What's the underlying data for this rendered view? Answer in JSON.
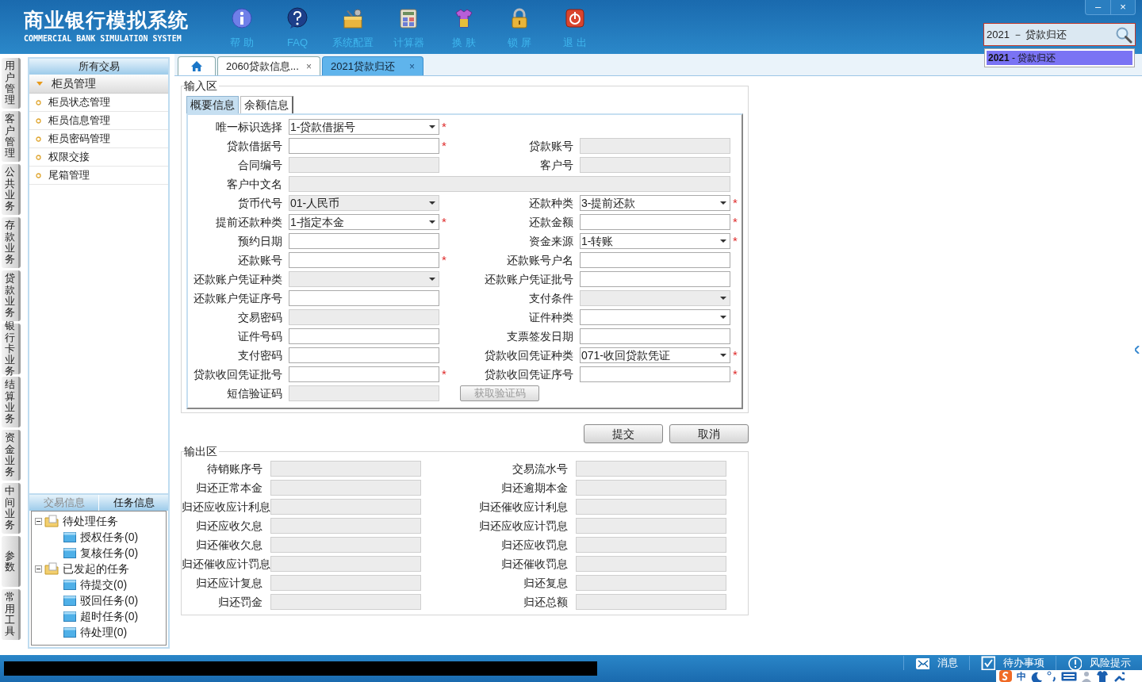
{
  "app": {
    "title": "商业银行模拟系统",
    "subtitle": "COMMERCIAL BANK SIMULATION SYSTEM"
  },
  "toolbar": [
    {
      "kind": "info",
      "label": "帮 助"
    },
    {
      "kind": "faq",
      "label": "FAQ"
    },
    {
      "kind": "config",
      "label": "系统配置"
    },
    {
      "kind": "calculator",
      "label": "计算器"
    },
    {
      "kind": "skin",
      "label": "换 肤"
    },
    {
      "kind": "lock",
      "label": "锁 屏"
    },
    {
      "kind": "exit",
      "label": "退 出"
    }
  ],
  "window_controls": [
    "–",
    "×"
  ],
  "search": {
    "value": "2021 － 贷款归还",
    "suggestion": "**2021** - 贷款归还"
  },
  "side_tabs": [
    "用户管理",
    "客户管理",
    "公共业务",
    "存款业务",
    "贷款业务",
    "银行卡业务",
    "结算业务",
    "资金业务",
    "中间业务",
    "参数",
    "常用工具"
  ],
  "menu": {
    "header": "所有交易",
    "group": "柜员管理",
    "expanded": true,
    "items": [
      "柜员状态管理",
      "柜员信息管理",
      "柜员密码管理",
      "权限交接",
      "尾箱管理"
    ]
  },
  "task_panel": {
    "tabs": [
      {
        "label": "交易信息",
        "selected": false
      },
      {
        "label": "任务信息",
        "selected": true
      }
    ],
    "tree": [
      {
        "label": "待处理任务",
        "expanded": true,
        "children": [
          {
            "label": "授权任务(0)"
          },
          {
            "label": "复核任务(0)"
          }
        ]
      },
      {
        "label": "已发起的任务",
        "expanded": true,
        "children": [
          {
            "label": "待提交(0)"
          },
          {
            "label": "驳回任务(0)"
          },
          {
            "label": "超时任务(0)"
          },
          {
            "label": "待处理(0)"
          }
        ]
      }
    ]
  },
  "doc_tabs": [
    {
      "kind": "home",
      "selected": false
    },
    {
      "kind": "page",
      "label": "2060贷款信息...",
      "close": "×",
      "selected": false
    },
    {
      "kind": "page",
      "label": "2021贷款归还",
      "close": "×",
      "selected": true
    }
  ],
  "input_area": {
    "title": "输入区",
    "required_mark": "*",
    "tabs": [
      {
        "label": "概要信息",
        "selected": true
      },
      {
        "label": "余额信息",
        "selected": false
      }
    ],
    "rows": [
      {
        "left": {
          "kind": "select",
          "label": "唯一标识选择",
          "value": "1-贷款借据号",
          "disabled": false,
          "required": true
        }
      },
      {
        "left": {
          "kind": "input",
          "label": "贷款借据号",
          "disabled": false,
          "required": true
        },
        "right": {
          "kind": "input",
          "label": "贷款账号",
          "disabled": true,
          "required": false
        }
      },
      {
        "left": {
          "kind": "input",
          "label": "合同编号",
          "disabled": true,
          "required": false
        },
        "right": {
          "kind": "input",
          "label": "客户号",
          "disabled": true,
          "required": false
        }
      },
      {
        "wide": {
          "kind": "input",
          "label": "客户中文名",
          "disabled": true,
          "required": false
        }
      },
      {
        "left": {
          "kind": "select",
          "label": "货币代号",
          "value": "01-人民币",
          "disabled": true,
          "required": false
        },
        "right": {
          "kind": "select",
          "label": "还款种类",
          "value": "3-提前还款",
          "disabled": false,
          "required": true
        }
      },
      {
        "left": {
          "kind": "select",
          "label": "提前还款种类",
          "value": "1-指定本金",
          "disabled": false,
          "required": true
        },
        "right": {
          "kind": "input",
          "label": "还款金额",
          "disabled": false,
          "required": true
        }
      },
      {
        "left": {
          "kind": "input",
          "label": "预约日期",
          "disabled": false,
          "required": false
        },
        "right": {
          "kind": "select",
          "label": "资金来源",
          "value": "1-转账",
          "disabled": false,
          "required": true
        }
      },
      {
        "left": {
          "kind": "input",
          "label": "还款账号",
          "disabled": false,
          "required": true
        },
        "right": {
          "kind": "input",
          "label": "还款账号户名",
          "disabled": false,
          "required": false
        }
      },
      {
        "left": {
          "kind": "select",
          "label": "还款账户凭证种类",
          "disabled": true,
          "required": false
        },
        "right": {
          "kind": "input",
          "label": "还款账户凭证批号",
          "disabled": false,
          "required": false
        }
      },
      {
        "left": {
          "kind": "input",
          "label": "还款账户凭证序号",
          "disabled": false,
          "required": false
        },
        "right": {
          "kind": "select",
          "label": "支付条件",
          "disabled": true,
          "required": false
        }
      },
      {
        "left": {
          "kind": "input",
          "label": "交易密码",
          "disabled": true,
          "required": false
        },
        "right": {
          "kind": "select",
          "label": "证件种类",
          "disabled": false,
          "required": false
        }
      },
      {
        "left": {
          "kind": "input",
          "label": "证件号码",
          "disabled": false,
          "required": false
        },
        "right": {
          "kind": "input",
          "label": "支票签发日期",
          "disabled": false,
          "required": false
        }
      },
      {
        "left": {
          "kind": "input",
          "label": "支付密码",
          "disabled": false,
          "required": false
        },
        "right": {
          "kind": "select",
          "label": "贷款收回凭证种类",
          "value": "071-收回贷款凭证",
          "disabled": false,
          "required": true
        }
      },
      {
        "left": {
          "kind": "input",
          "label": "贷款收回凭证批号",
          "disabled": false,
          "required": true
        },
        "right": {
          "kind": "input",
          "label": "贷款收回凭证序号",
          "disabled": false,
          "required": true
        }
      },
      {
        "left": {
          "kind": "input",
          "label": "短信验证码",
          "disabled": true,
          "required": false
        },
        "right": {
          "kind": "button",
          "label": "获取验证码",
          "disabled": true
        }
      }
    ]
  },
  "actions": [
    "提交",
    "取消"
  ],
  "output_area": {
    "title": "输出区",
    "rows": [
      {
        "left": "待销账序号",
        "right": "交易流水号"
      },
      {
        "left": "归还正常本金",
        "right": "归还逾期本金"
      },
      {
        "left": "归还应收应计利息",
        "right": "归还催收应计利息"
      },
      {
        "left": "归还应收欠息",
        "right": "归还应收应计罚息"
      },
      {
        "left": "归还催收欠息",
        "right": "归还应收罚息"
      },
      {
        "left": "归还催收应计罚息",
        "right": "归还催收罚息"
      },
      {
        "left": "归还应计复息",
        "right": "归还复息"
      },
      {
        "left": "归还罚金",
        "right": "归还总额"
      }
    ]
  },
  "status_bar": {
    "items": [
      {
        "kind": "message",
        "label": "消息"
      },
      {
        "kind": "todo",
        "label": "待办事项"
      },
      {
        "kind": "risk",
        "label": "风险提示"
      }
    ]
  },
  "ime": {
    "label": "中"
  }
}
